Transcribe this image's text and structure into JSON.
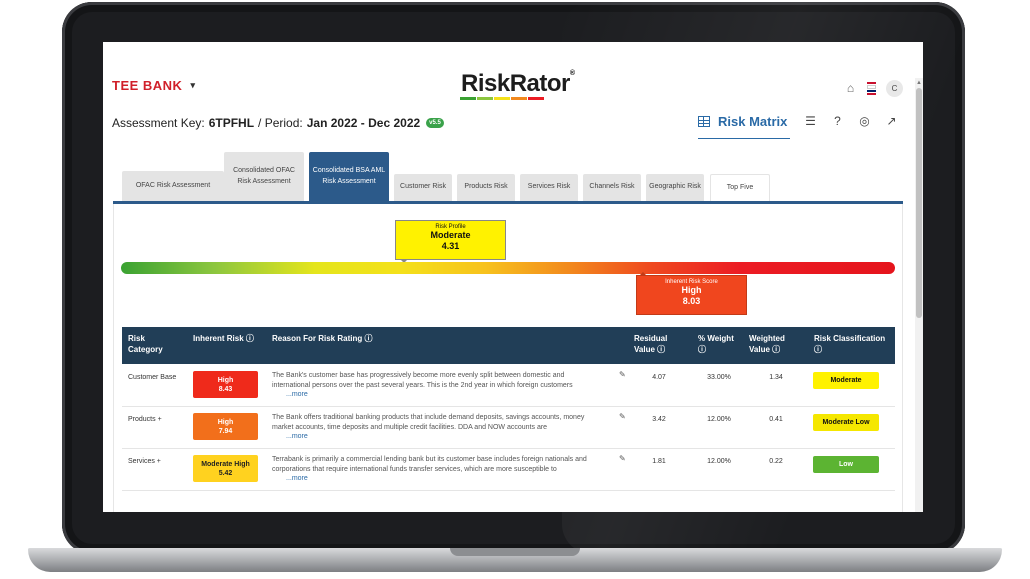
{
  "header": {
    "bank_name": "TEE BANK",
    "bank_caret": "▾",
    "logo_part1": "Risk",
    "logo_part2": "Rator",
    "logo_mark": "®",
    "avatar_initial": "C"
  },
  "assessment": {
    "key_label": "Assessment Key:",
    "key_value": "6TPFHL",
    "period_label": "/ Period:",
    "period_value": "Jan 2022 - Dec 2022",
    "version": "v5.5",
    "view_title": "Risk Matrix"
  },
  "tabs": [
    {
      "label": "OFAC Risk Assessment"
    },
    {
      "label": "Consolidated OFAC Risk Assessment"
    },
    {
      "label": "Consolidated BSA AML Risk Assessment"
    },
    {
      "label": "Customer Risk"
    },
    {
      "label": "Products Risk"
    },
    {
      "label": "Services Risk"
    },
    {
      "label": "Channels Risk"
    },
    {
      "label": "Geographic Risk"
    },
    {
      "label": "Top Five"
    }
  ],
  "gauge": {
    "profile": {
      "label": "Risk Profile",
      "level": "Moderate",
      "score": "4.31"
    },
    "inherent": {
      "label": "Inherent Risk Score",
      "level": "High",
      "score": "8.03"
    }
  },
  "table": {
    "headers": {
      "category": "Risk Category",
      "inherent": "Inherent Risk ⓘ",
      "reason": "Reason For Risk Rating ⓘ",
      "residual": "Residual Value ⓘ",
      "weight": "% Weight ⓘ",
      "weighted": "Weighted Value ⓘ",
      "classification": "Risk Classification ⓘ"
    },
    "rows": [
      {
        "category": "Customer Base",
        "risk_level": "High",
        "risk_score": "8.43",
        "reason": "The Bank's customer base has progressively become more evenly split between domestic and international persons over the past several years. This is the 2nd year in which foreign customers",
        "more": "...more",
        "residual": "4.07",
        "weight": "33.00%",
        "weighted": "1.34",
        "classification": "Moderate"
      },
      {
        "category": "Products +",
        "risk_level": "High",
        "risk_score": "7.94",
        "reason": "The Bank offers traditional banking products that include demand deposits, savings accounts, money market accounts, time deposits and multiple credit facilities. DDA and NOW accounts are",
        "more": "...more",
        "residual": "3.42",
        "weight": "12.00%",
        "weighted": "0.41",
        "classification": "Moderate Low"
      },
      {
        "category": "Services +",
        "risk_level": "Moderate High",
        "risk_score": "5.42",
        "reason": "Terrabank is primarily a commercial lending bank but its customer base includes foreign nationals and corporations that require international funds transfer services, which are more susceptible to",
        "more": "...more",
        "residual": "1.81",
        "weight": "12.00%",
        "weighted": "0.22",
        "classification": "Low"
      }
    ]
  },
  "colors": {
    "brand_red": "#d0202a",
    "primary_blue": "#2c5a8a",
    "table_header": "#213e57",
    "high": "#ef2a1b",
    "high_orange": "#f26f1b",
    "moderate_high": "#ffd21f",
    "moderate": "#fff200",
    "moderate_low": "#f5e700",
    "low": "#5cb432"
  }
}
